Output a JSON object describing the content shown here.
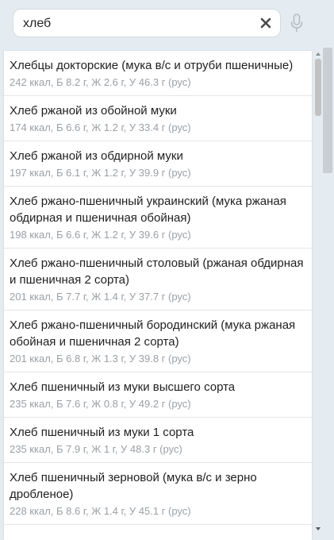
{
  "search": {
    "value": "хлеб",
    "placeholder": ""
  },
  "icons": {
    "clear": "close-icon",
    "voice": "microphone-icon"
  },
  "results": [
    {
      "name": "Хлебцы докторские (мука в/с и отруби пшеничные)",
      "info": "242 ккал, Б 8.2 г, Ж 2.6 г, У 46.3 г (рус)"
    },
    {
      "name": "Хлеб ржаной из обойной муки",
      "info": "174 ккал, Б 6.6 г, Ж 1.2 г, У 33.4 г (рус)"
    },
    {
      "name": "Хлеб ржаной из обдирной муки",
      "info": "197 ккал, Б 6.1 г, Ж 1.2 г, У 39.9 г (рус)"
    },
    {
      "name": "Хлеб ржано-пшеничный украинский (мука ржаная обдирная и пшеничная обойная)",
      "info": "198 ккал, Б 6.6 г, Ж 1.2 г, У 39.6 г (рус)"
    },
    {
      "name": "Хлеб ржано-пшеничный столовый (ржаная обдирная и пшеничная 2 сорта)",
      "info": "201 ккал, Б 7.7 г, Ж 1.4 г, У 37.7 г (рус)"
    },
    {
      "name": "Хлеб ржано-пшеничный бородинский (мука ржаная обойная и пшеничная 2 сорта)",
      "info": "201 ккал, Б 6.8 г, Ж 1.3 г, У 39.8 г (рус)"
    },
    {
      "name": "Хлеб пшеничный из муки высшего сорта",
      "info": "235 ккал, Б 7.6 г, Ж 0.8 г, У 49.2 г (рус)"
    },
    {
      "name": "Хлеб пшеничный из муки 1 сорта",
      "info": "235 ккал, Б 7.9 г, Ж 1 г, У 48.3 г (рус)"
    },
    {
      "name": "Хлеб пшеничный зерновой (мука в/с и зерно дробленое)",
      "info": "228 ккал, Б 8.6 г, Ж 1.4 г, У 45.1 г (рус)"
    }
  ],
  "colors": {
    "background": "#e4ecf1",
    "name_text": "#1f1f1f",
    "info_text": "#9aa0a6",
    "divider": "#e2e6e9"
  }
}
